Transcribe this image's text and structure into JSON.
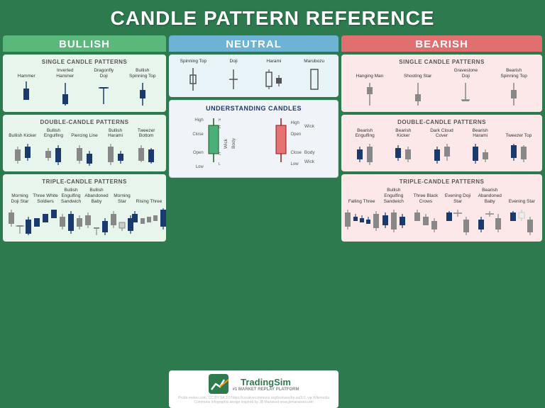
{
  "title": "CANDLE PATTERN REFERENCE",
  "columns": {
    "bullish": {
      "label": "BULLISH",
      "color": "#5ab87a",
      "single_title": "SINGLE CANDLE PATTERNS",
      "single_patterns": [
        {
          "name": "Hammer"
        },
        {
          "name": "Inverted\nHammer"
        },
        {
          "name": "Dragonfly\nDoji"
        },
        {
          "name": "Bullish\nSpinning Top"
        }
      ],
      "double_title": "DOUBLE-CANDLE PATTERNS",
      "double_patterns": [
        {
          "name": "Bullish\nKicker"
        },
        {
          "name": "Bullish\nEngulfing"
        },
        {
          "name": "Piercing\nLine"
        },
        {
          "name": "Bullish\nHarami"
        },
        {
          "name": "Tweezer\nBottom"
        }
      ],
      "triple_title": "TRIPLE-CANDLE PATTERNS",
      "triple_patterns": [
        {
          "name": "Morning\nDoji Star"
        },
        {
          "name": "Three White\nSoldiers"
        },
        {
          "name": "Bullish\nEngulfing\nSandwich"
        },
        {
          "name": "Bullish\nAbandoned\nBaby"
        },
        {
          "name": "Morning\nStar"
        },
        {
          "name": "Rising\nThree"
        }
      ]
    },
    "neutral": {
      "label": "NEUTRAL",
      "color": "#6db3d4",
      "single_patterns": [
        {
          "name": "Spinning\nTop"
        },
        {
          "name": "Doji"
        },
        {
          "name": "Harami"
        },
        {
          "name": "Marubozu"
        }
      ],
      "understanding_title": "UNDERSTANDING CANDLES"
    },
    "bearish": {
      "label": "BEARISH",
      "color": "#e07070",
      "single_title": "SINGLE CANDLE PATTERNS",
      "single_patterns": [
        {
          "name": "Hanging Man"
        },
        {
          "name": "Shooting Star"
        },
        {
          "name": "Gravestone Doji"
        },
        {
          "name": "Bearish\nSpinning Top"
        }
      ],
      "double_title": "DOUBLE-CANDLE PATTERNS",
      "double_patterns": [
        {
          "name": "Bearish\nEngulfing"
        },
        {
          "name": "Bearish\nKicker"
        },
        {
          "name": "Dark Cloud\nCover"
        },
        {
          "name": "Bearish\nHarami"
        },
        {
          "name": "Tweezer\nTop"
        }
      ],
      "triple_title": "TRIPLE-CANDLE PATTERNS",
      "triple_patterns": [
        {
          "name": "Falling\nThree"
        },
        {
          "name": "Bullish\nEngulfing\nSandwich"
        },
        {
          "name": "Three Black\nCrows"
        },
        {
          "name": "Evening\nDoji Star"
        },
        {
          "name": "Bearish\nAbandoned\nBaby"
        },
        {
          "name": "Evening\nStar"
        }
      ]
    }
  },
  "footer": {
    "brand_name": "TradingSim",
    "brand_sub": "#1 MARKET REPLAY PLATFORM",
    "credits": "Probe-meteo.com, CC BY-SA 3.0 https://creativecommons.org/licenses/by-sa/3.0, via Wikimedia Commons    Infographic design inspired by JB Marwood www.jbmarwood.com"
  }
}
